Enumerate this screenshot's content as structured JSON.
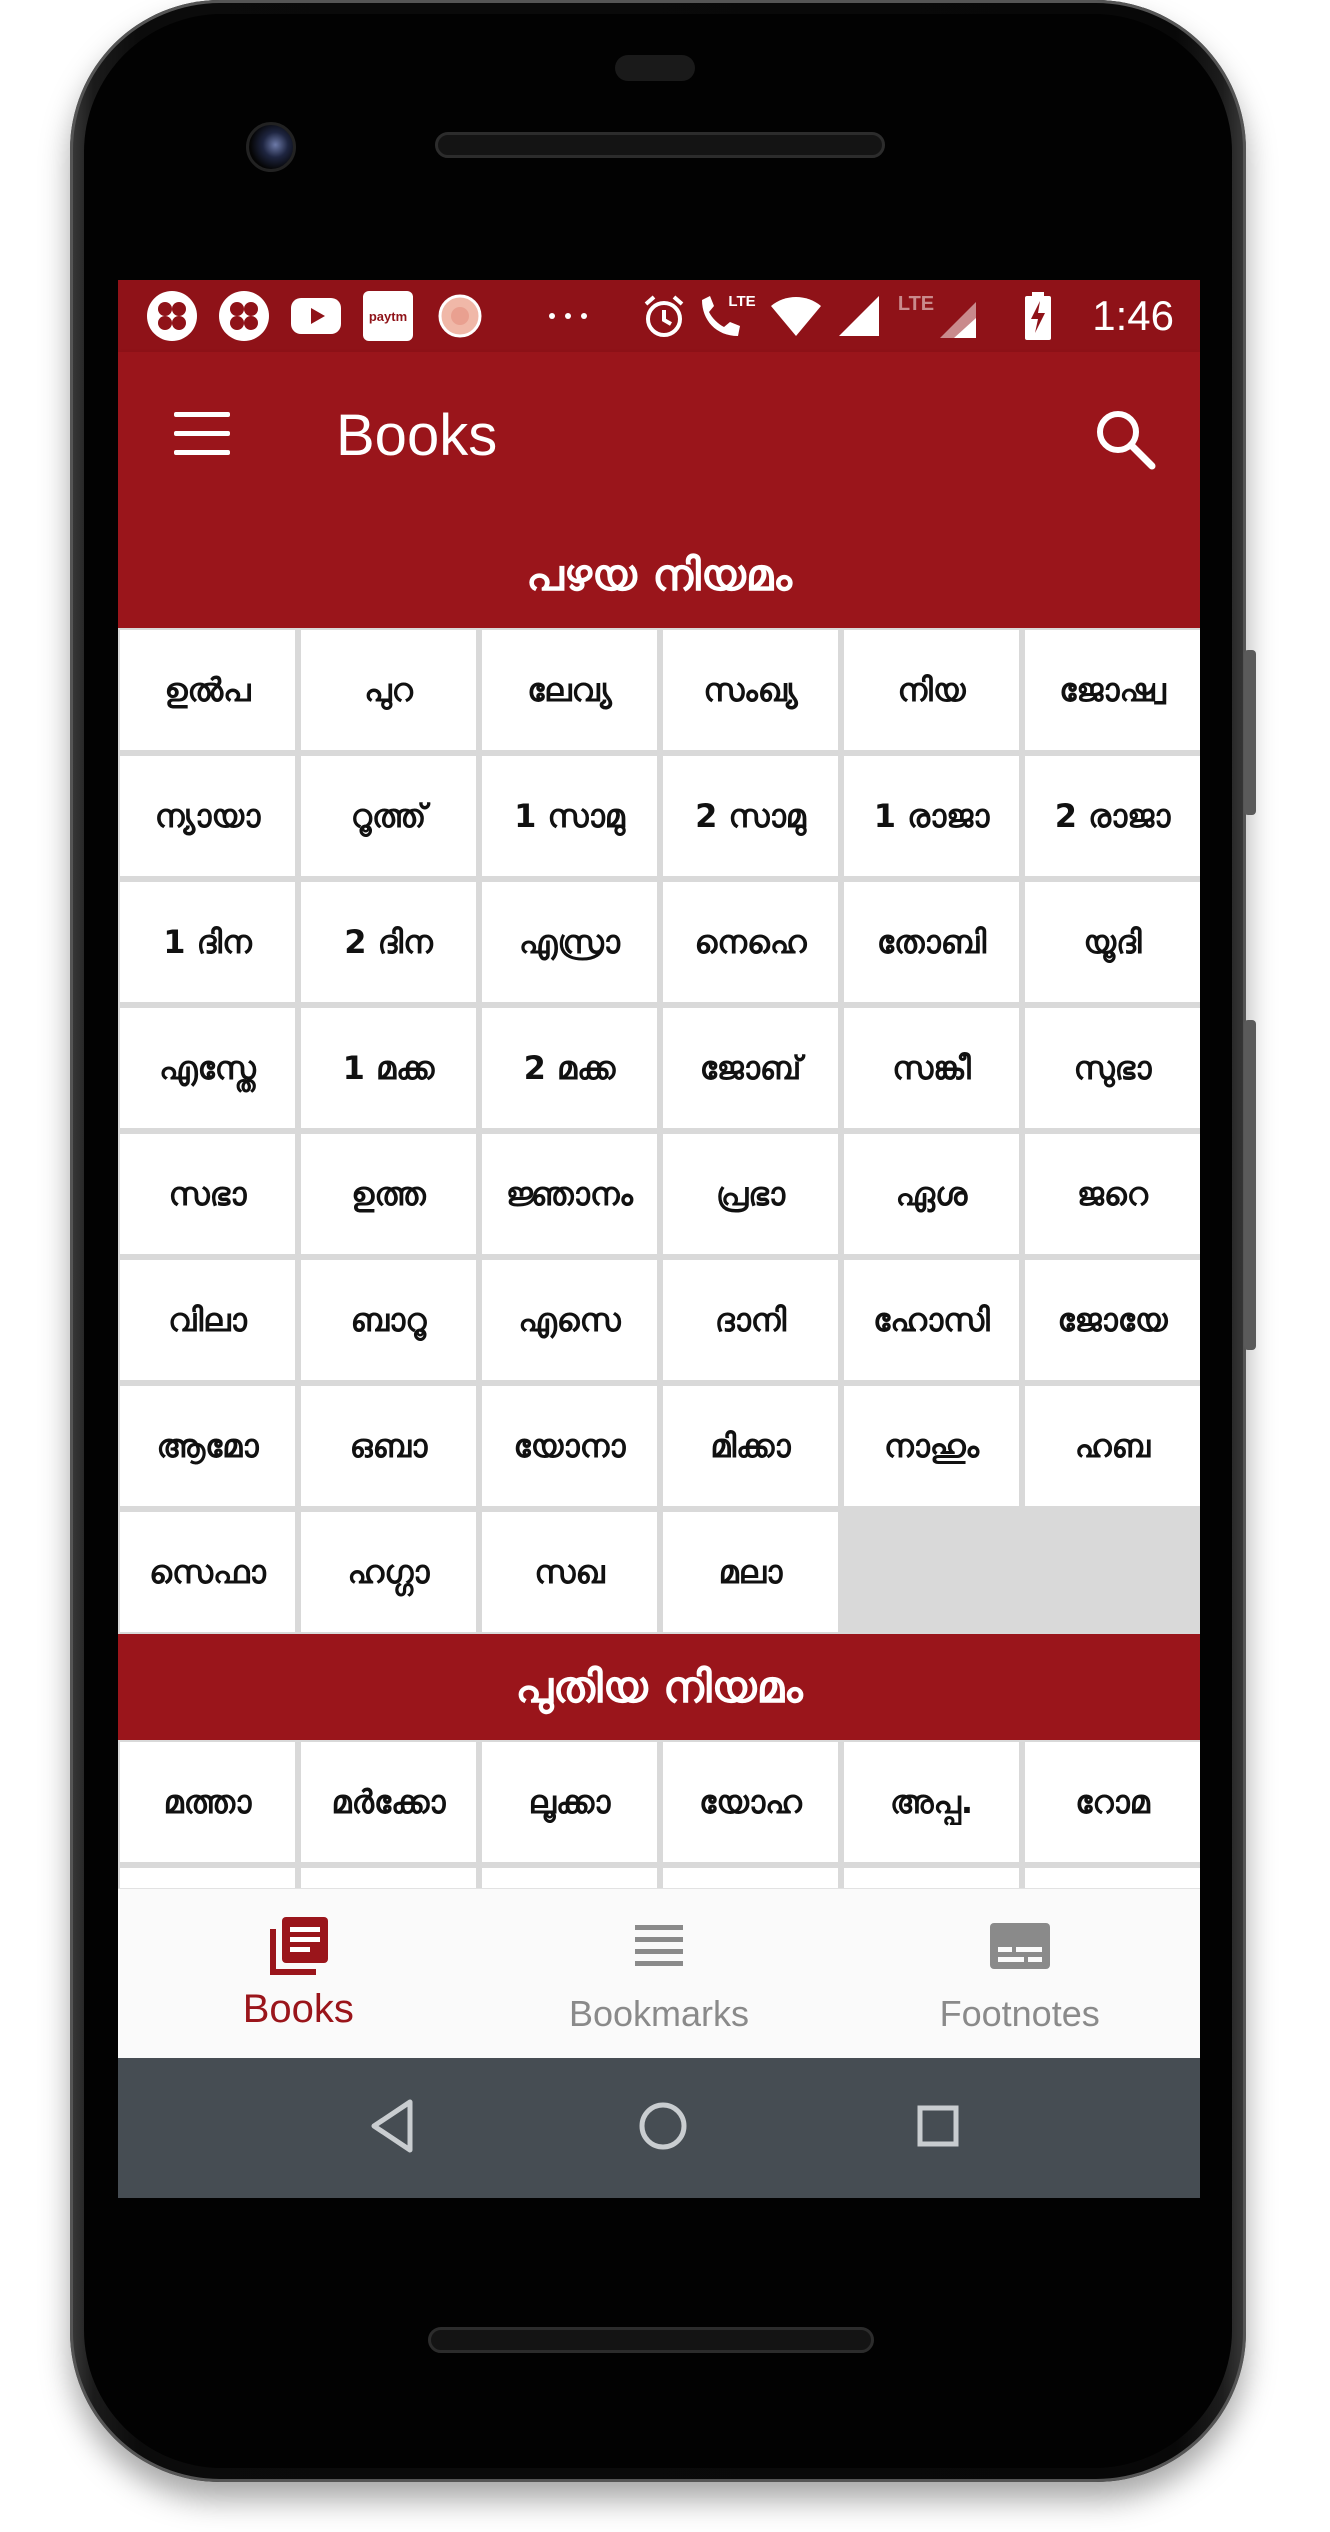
{
  "status_bar": {
    "icons": [
      "app-flower-icon",
      "app-flower-icon",
      "youtube-icon",
      "paytm-icon",
      "camera-shutter-icon",
      "more-dots-icon",
      "alarm-icon",
      "volte-call-icon",
      "wifi-icon",
      "signal-icon",
      "lte-signal-icon",
      "battery-charging-icon"
    ],
    "paytm_label": "paytm",
    "lte_label": "LTE",
    "time": "1:46"
  },
  "app_bar": {
    "title": "Books"
  },
  "old_testament": {
    "header": "പഴയ നിയമം",
    "books": [
      "ഉൽപ",
      "പുറ",
      "ലേവ്യ",
      "സംഖ്യ",
      "നിയ",
      "ജോഷ്വ",
      "ന്യായാ",
      "റൂത്ത്",
      "1 സാമു",
      "2 സാമു",
      "1 രാജാ",
      "2 രാജാ",
      "1 ദിന",
      "2 ദിന",
      "എസ്രാ",
      "നെഹെ",
      "തോബി",
      "യൂദി",
      "എസ്തേ",
      "1 മക്ക",
      "2 മക്ക",
      "ജോബ്",
      "സങ്കീ",
      "സുഭാ",
      "സഭാ",
      "ഉത്ത",
      "ജ്ഞാനം",
      "പ്രഭാ",
      "ഏശ",
      "ജറെ",
      "വിലാ",
      "ബാറൂ",
      "എസെ",
      "ദാനി",
      "ഹോസി",
      "ജോയേ",
      "ആമോ",
      "ഒബാ",
      "യോനാ",
      "മിക്കാ",
      "നാഹും",
      "ഹബ",
      "സെഫാ",
      "ഹഗ്ഗാ",
      "സഖ",
      "മലാ"
    ]
  },
  "new_testament": {
    "header": "പുതിയ നിയമം",
    "books": [
      "മത്താ",
      "മർക്കോ",
      "ലൂക്കാ",
      "യോഹ",
      "അപ്പ.",
      "റോമ"
    ]
  },
  "bottom_nav": {
    "items": [
      {
        "label": "Books",
        "icon": "books-icon",
        "active": true
      },
      {
        "label": "Bookmarks",
        "icon": "bookmarks-list-icon",
        "active": false
      },
      {
        "label": "Footnotes",
        "icon": "footnotes-icon",
        "active": false
      }
    ]
  },
  "colors": {
    "primary": "#9a151b",
    "status_bar": "#8f1218",
    "system_nav": "#464d53",
    "inactive": "#8a8a8a"
  }
}
